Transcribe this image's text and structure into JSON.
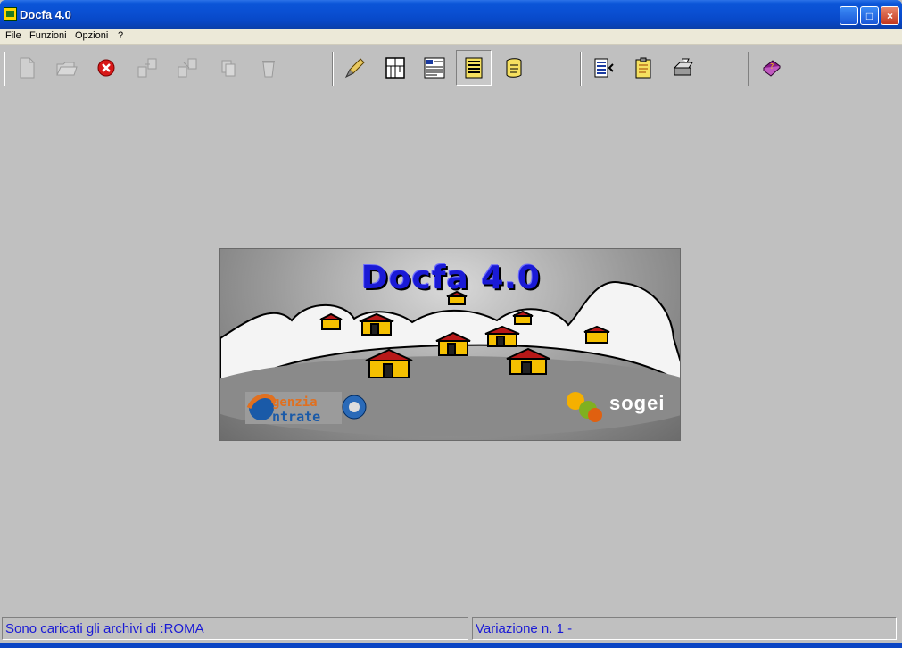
{
  "window": {
    "title": "Docfa 4.0"
  },
  "titlebar_buttons": {
    "minimize": "_",
    "maximize": "□",
    "close": "×"
  },
  "menu": {
    "items": [
      "File",
      "Funzioni",
      "Opzioni",
      "?"
    ]
  },
  "toolbar": {
    "tools": [
      {
        "name": "new-document-icon",
        "enabled": false
      },
      {
        "name": "open-folder-icon",
        "enabled": false
      },
      {
        "name": "cancel-icon",
        "enabled": true
      },
      {
        "name": "export-icon",
        "enabled": false
      },
      {
        "name": "import-icon",
        "enabled": false
      },
      {
        "name": "copy-icon",
        "enabled": false
      },
      {
        "name": "recycle-icon",
        "enabled": false
      },
      {
        "name": "brush-icon",
        "enabled": true
      },
      {
        "name": "floor-plan-icon",
        "enabled": true
      },
      {
        "name": "form-icon",
        "enabled": true
      },
      {
        "name": "list-icon",
        "enabled": true,
        "pressed": true
      },
      {
        "name": "scroll-icon",
        "enabled": true
      },
      {
        "name": "report-icon",
        "enabled": true
      },
      {
        "name": "notepad-icon",
        "enabled": true
      },
      {
        "name": "printer-icon",
        "enabled": true
      },
      {
        "name": "help-book-icon",
        "enabled": true
      }
    ]
  },
  "splash": {
    "title": "Docfa 4.0",
    "agency_line1": "genzia",
    "agency_line2": "ntrate",
    "partner": "sogei"
  },
  "status": {
    "left": "Sono caricati gli archivi di :ROMA",
    "right": "Variazione n.   1 -"
  },
  "colors": {
    "title_blue": "#0a4fd2",
    "status_text": "#1a1ad6",
    "house_yellow": "#f5c000",
    "roof_red": "#b81818"
  }
}
